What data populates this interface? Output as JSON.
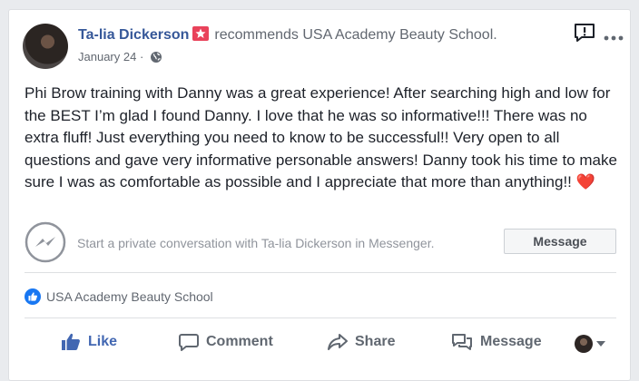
{
  "post": {
    "author": "Ta-lia Dickerson",
    "recommends_prefix": "recommends",
    "page_name": "USA Academy Beauty School.",
    "date": "January 24",
    "date_separator": "·",
    "text": "Phi Brow training with Danny was a great experience! After searching high and low for the BEST I’m glad I found Danny. I love that he was so informative!!! There was no extra fluff! Just everything you need to know to be successful!! Very open to all questions and gave very informative personable answers! Danny took his time to make sure I was as comfortable as possible and I appreciate that more than anything!!",
    "emoji": "❤️"
  },
  "messenger": {
    "prompt": "Start a private conversation with Ta-lia Dickerson in Messenger.",
    "button_label": "Message"
  },
  "likes": {
    "liker": "USA Academy Beauty School"
  },
  "actions": {
    "like": "Like",
    "comment": "Comment",
    "share": "Share",
    "message": "Message"
  },
  "icons": {
    "recommend": "star-badge-icon",
    "privacy": "globe-icon",
    "report": "report-icon",
    "more": "more-options-icon",
    "messenger": "messenger-icon",
    "like_badge": "thumbs-up-icon"
  },
  "colors": {
    "link": "#365899",
    "like_active": "#4267b2",
    "recommend_badge": "#e9425a",
    "heart": "#e0245e"
  }
}
